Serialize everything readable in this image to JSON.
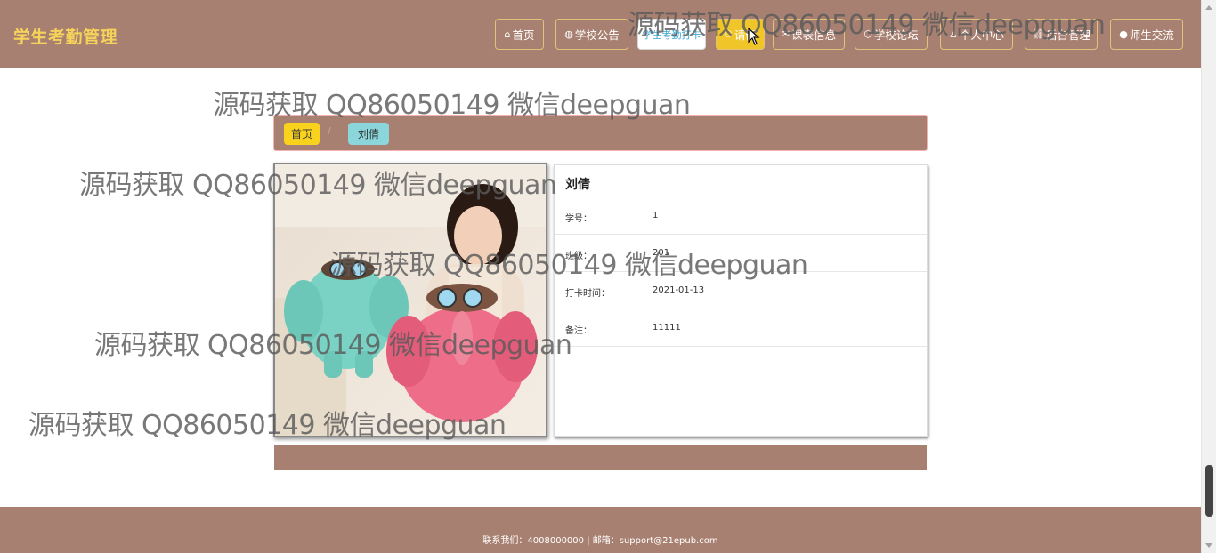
{
  "header": {
    "brand": "学生考勤管理",
    "nav": [
      {
        "icon": "⌂",
        "label": "首页"
      },
      {
        "icon": "◍",
        "label": "学校公告"
      },
      {
        "icon": "",
        "label": "学生考勤打卡"
      },
      {
        "icon": "⚇",
        "label": "请假"
      },
      {
        "icon": "✉",
        "label": "课表信息"
      },
      {
        "icon": "⬡",
        "label": "学校论坛"
      },
      {
        "icon": "♙",
        "label": "个人中心"
      },
      {
        "icon": "⛓",
        "label": "后台管理"
      },
      {
        "icon": "●",
        "label": "师生交流"
      }
    ]
  },
  "breadcrumb": {
    "home": "首页",
    "separator": "/",
    "current": "刘倩"
  },
  "detail": {
    "name": "刘倩",
    "fields": [
      {
        "label": "学号：",
        "value": "1"
      },
      {
        "label": "班级：",
        "value": "201"
      },
      {
        "label": "打卡时间：",
        "value": "2021-01-13"
      },
      {
        "label": "备注：",
        "value": "11111"
      }
    ]
  },
  "footer": {
    "text": "联系我们：4008000000 | 邮箱：support@21epub.com"
  },
  "watermarks": [
    "源码获取 QQ86050149 微信deepguan",
    "源码获取 QQ86050149 微信deepguan",
    "源码获取 QQ86050149 微信deepguan",
    "源码获取 QQ86050149 微信deepguan",
    "源码获取 QQ86050149 微信deepguan",
    "源码获取 QQ86050149 微信deepguan"
  ],
  "colors": {
    "header_bg": "#a88071",
    "brand": "#f5d35a",
    "nav_active_yellow": "#f0c52a",
    "crumb_home": "#f8d21c",
    "crumb_current": "#8ad6da"
  }
}
